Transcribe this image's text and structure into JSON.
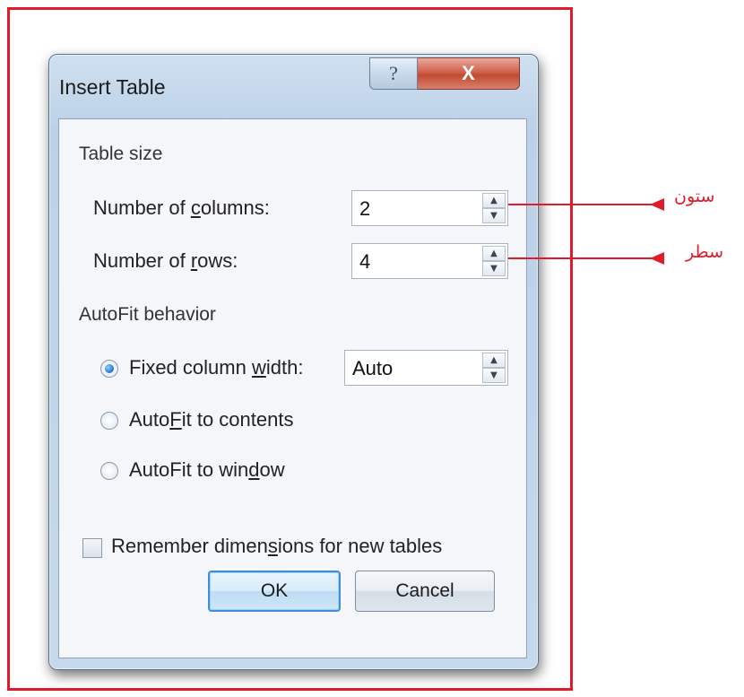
{
  "dialog": {
    "title": "Insert Table",
    "help_label": "?",
    "close_label": "X"
  },
  "table_size": {
    "group_label": "Table size",
    "columns_label_pre": "Number of ",
    "columns_label_u": "c",
    "columns_label_post": "olumns:",
    "columns_value": "2",
    "rows_label_pre": "Number of ",
    "rows_label_u": "r",
    "rows_label_post": "ows:",
    "rows_value": "4"
  },
  "autofit": {
    "group_label": "AutoFit behavior",
    "fixed_label_pre": "Fixed column ",
    "fixed_label_u": "w",
    "fixed_label_post": "idth:",
    "fixed_value": "Auto",
    "contents_label_pre": "Auto",
    "contents_label_u": "F",
    "contents_label_post": "it to contents",
    "window_label_pre": "AutoFit to win",
    "window_label_u": "d",
    "window_label_post": "ow",
    "selected": "fixed"
  },
  "remember": {
    "label_pre": "Remember dimen",
    "label_u": "s",
    "label_post": "ions for new tables",
    "checked": false
  },
  "buttons": {
    "ok_label": "OK",
    "cancel_label": "Cancel"
  },
  "annotations": {
    "columns_note": "ستون",
    "rows_note": "سطر",
    "color": "#e21b2b"
  }
}
